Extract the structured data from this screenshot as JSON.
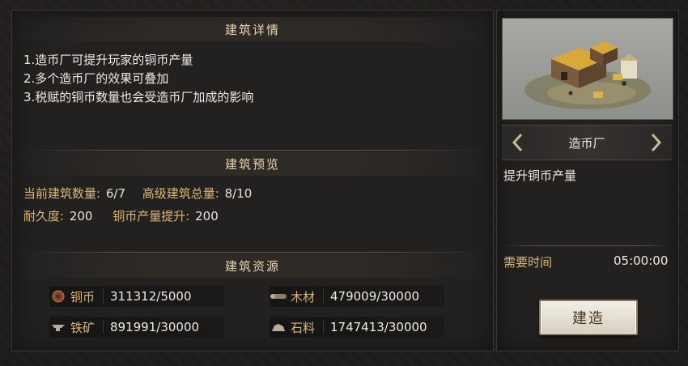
{
  "details": {
    "title": "建筑详情",
    "lines": [
      "1.造币厂可提升玩家的铜币产量",
      "2.多个造币厂的效果可叠加",
      "3.税赋的铜币数量也会受造币厂加成的影响"
    ]
  },
  "preview_section": {
    "title": "建筑预览",
    "current_count_label": "当前建筑数量:",
    "current_count_value": "6/7",
    "advanced_total_label": "高级建筑总量:",
    "advanced_total_value": "8/10",
    "durability_label": "耐久度:",
    "durability_value": "200",
    "copper_boost_label": "铜币产量提升:",
    "copper_boost_value": "200"
  },
  "resources": {
    "title": "建筑资源",
    "items": [
      {
        "name": "铜币",
        "value": "311312/5000",
        "icon": "copper-coin-icon"
      },
      {
        "name": "木材",
        "value": "479009/30000",
        "icon": "wood-icon"
      },
      {
        "name": "铁矿",
        "value": "891991/30000",
        "icon": "iron-ore-icon"
      },
      {
        "name": "石料",
        "value": "1747413/30000",
        "icon": "stone-icon"
      }
    ]
  },
  "building": {
    "name": "造币厂",
    "description": "提升铜币产量",
    "time_label": "需要时间",
    "time_value": "05:00:00",
    "build_label": "建造"
  },
  "colors": {
    "accent_gold": "#d9b77a",
    "text": "#efe9df",
    "panel": "#222120"
  }
}
